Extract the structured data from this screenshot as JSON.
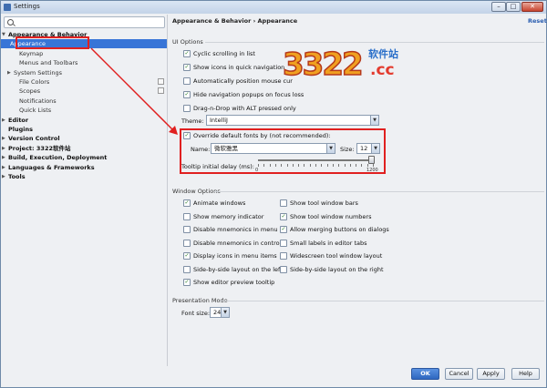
{
  "window": {
    "title": "Settings"
  },
  "window_controls": {
    "minimize": "–",
    "maximize": "□",
    "close": "✕"
  },
  "icons": {
    "search": "search-icon",
    "check": "✓",
    "dropdown": "▼",
    "collapsed": "▶",
    "expanded": "▼",
    "close": "close-icon"
  },
  "search": {
    "value": "",
    "placeholder": ""
  },
  "tree": [
    {
      "label": "Appearance & Behavior",
      "state": "expanded",
      "bold": true
    },
    {
      "label": "Appearance",
      "selected": true
    },
    {
      "label": "Keymap"
    },
    {
      "label": "Menus and Toolbars"
    },
    {
      "label": "System Settings",
      "state": "collapsed"
    },
    {
      "label": "File Colors"
    },
    {
      "label": "Scopes"
    },
    {
      "label": "Notifications"
    },
    {
      "label": "Quick Lists"
    },
    {
      "label": "Editor",
      "state": "collapsed",
      "bold": true
    },
    {
      "label": "Plugins",
      "bold": true
    },
    {
      "label": "Version Control",
      "state": "collapsed",
      "bold": true
    },
    {
      "label": "Project: 3322软件站",
      "state": "collapsed",
      "bold": true
    },
    {
      "label": "Build, Execution, Deployment",
      "state": "collapsed",
      "bold": true
    },
    {
      "label": "Languages & Frameworks",
      "state": "collapsed",
      "bold": true
    },
    {
      "label": "Tools",
      "state": "collapsed",
      "bold": true
    }
  ],
  "header": {
    "breadcrumb": "Appearance & Behavior › Appearance",
    "reset": "Reset"
  },
  "ui_options": {
    "title": "UI Options",
    "checkboxes": [
      {
        "label": "Cyclic scrolling in list",
        "checked": true
      },
      {
        "label": "Show icons in quick navigation",
        "checked": true
      },
      {
        "label": "Automatically position mouse cur",
        "checked": false
      },
      {
        "label": "Hide navigation popups on focus loss",
        "checked": true
      },
      {
        "label": "Drag-n-Drop with ALT pressed only",
        "checked": false
      }
    ],
    "theme_label": "Theme:",
    "theme_value": "IntelliJ",
    "override_fonts": {
      "label": "Override default fonts by (not recommended):",
      "checked": true
    },
    "name_label": "Name:",
    "name_value": "微软雅黑",
    "size_label": "Size:",
    "size_value": "12",
    "tooltip_label": "Tooltip initial delay (ms):",
    "tooltip_min": "0",
    "tooltip_max": "1200",
    "tooltip_level": 1.0
  },
  "window_options": {
    "title": "Window Options",
    "left": [
      {
        "label": "Animate windows",
        "checked": true
      },
      {
        "label": "Show memory indicator",
        "checked": false
      },
      {
        "label": "Disable mnemonics in menu",
        "checked": false
      },
      {
        "label": "Disable mnemonics in controls",
        "checked": false
      },
      {
        "label": "Display icons in menu items",
        "checked": true
      },
      {
        "label": "Side-by-side layout on the left",
        "checked": false
      },
      {
        "label": "Show editor preview tooltip",
        "checked": true
      }
    ],
    "right": [
      {
        "label": "Show tool window bars",
        "checked": false
      },
      {
        "label": "Show tool window numbers",
        "checked": true
      },
      {
        "label": "Allow merging buttons on dialogs",
        "checked": true
      },
      {
        "label": "Small labels in editor tabs",
        "checked": false
      },
      {
        "label": "Widescreen tool window layout",
        "checked": false
      },
      {
        "label": "Side-by-side layout on the right",
        "checked": false
      }
    ]
  },
  "presentation": {
    "title": "Presentation Mode",
    "font_size_label": "Font size:",
    "font_size_value": "24"
  },
  "logo": {
    "number": "3322",
    "chinese": "软件站",
    "domain": ".cc"
  },
  "buttons": {
    "ok": "OK",
    "cancel": "Cancel",
    "apply": "Apply",
    "help": "Help"
  },
  "colors": {
    "selection": "#3875d7",
    "highlight": "#e02020",
    "link": "#2a5db0"
  }
}
